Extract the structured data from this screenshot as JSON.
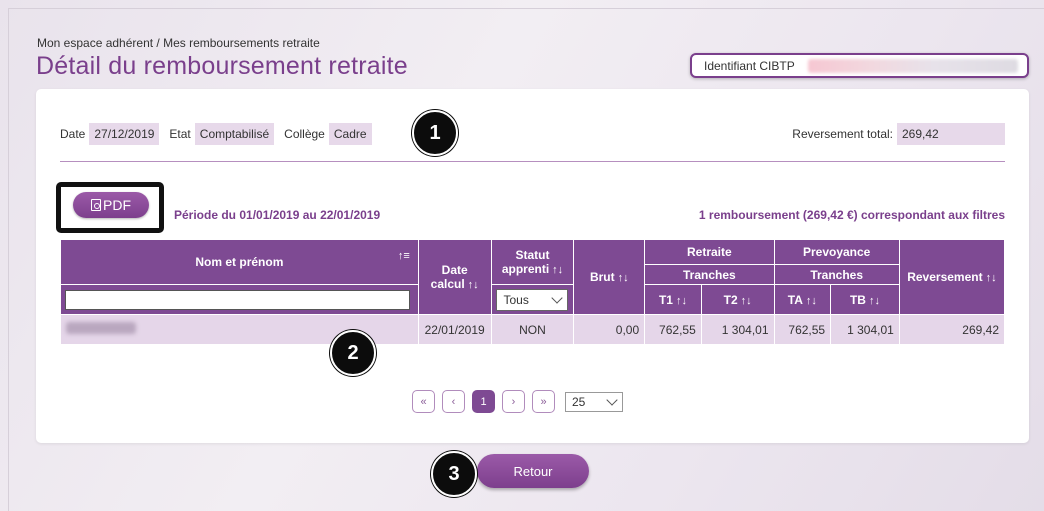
{
  "breadcrumb": "Mon espace adhérent / Mes remboursements retraite",
  "title": "Détail du remboursement retraite",
  "identifiant_label": "Identifiant CIBTP",
  "meta": {
    "date_label": "Date",
    "date_value": "27/12/2019",
    "etat_label": "Etat",
    "etat_value": "Comptabilisé",
    "college_label": "Collège",
    "college_value": "Cadre",
    "total_label": "Reversement total:",
    "total_value": "269,42"
  },
  "pdf_label": "PDF",
  "period": "Période du 01/01/2019 au 22/01/2019",
  "count": "1 remboursement (269,42 €) correspondant aux filtres",
  "table": {
    "headers": {
      "nom": "Nom et prénom",
      "date_calcul": "Date calcul",
      "statut": "Statut apprenti",
      "brut": "Brut",
      "retraite": "Retraite",
      "prevoyance": "Prevoyance",
      "tranches": "Tranches",
      "t1": "T1",
      "t2": "T2",
      "ta": "TA",
      "tb": "TB",
      "reversement": "Reversement"
    },
    "sort_glyph": "↑↓",
    "sort_active_glyph": "↑≡",
    "statut_filter": "Tous",
    "rows": [
      {
        "date_calcul": "22/01/2019",
        "statut": "NON",
        "brut": "0,00",
        "t1": "762,55",
        "t2": "1 304,01",
        "ta": "762,55",
        "tb": "1 304,01",
        "reversement": "269,42"
      }
    ]
  },
  "pager": {
    "first": "«",
    "prev": "‹",
    "current": "1",
    "next": "›",
    "last": "»",
    "page_size": "25"
  },
  "retour_label": "Retour",
  "badges": [
    "1",
    "2",
    "3"
  ],
  "colors": {
    "accent": "#7e4a93",
    "cell_bg": "#e5d6e9",
    "title": "#7a3f8c"
  }
}
